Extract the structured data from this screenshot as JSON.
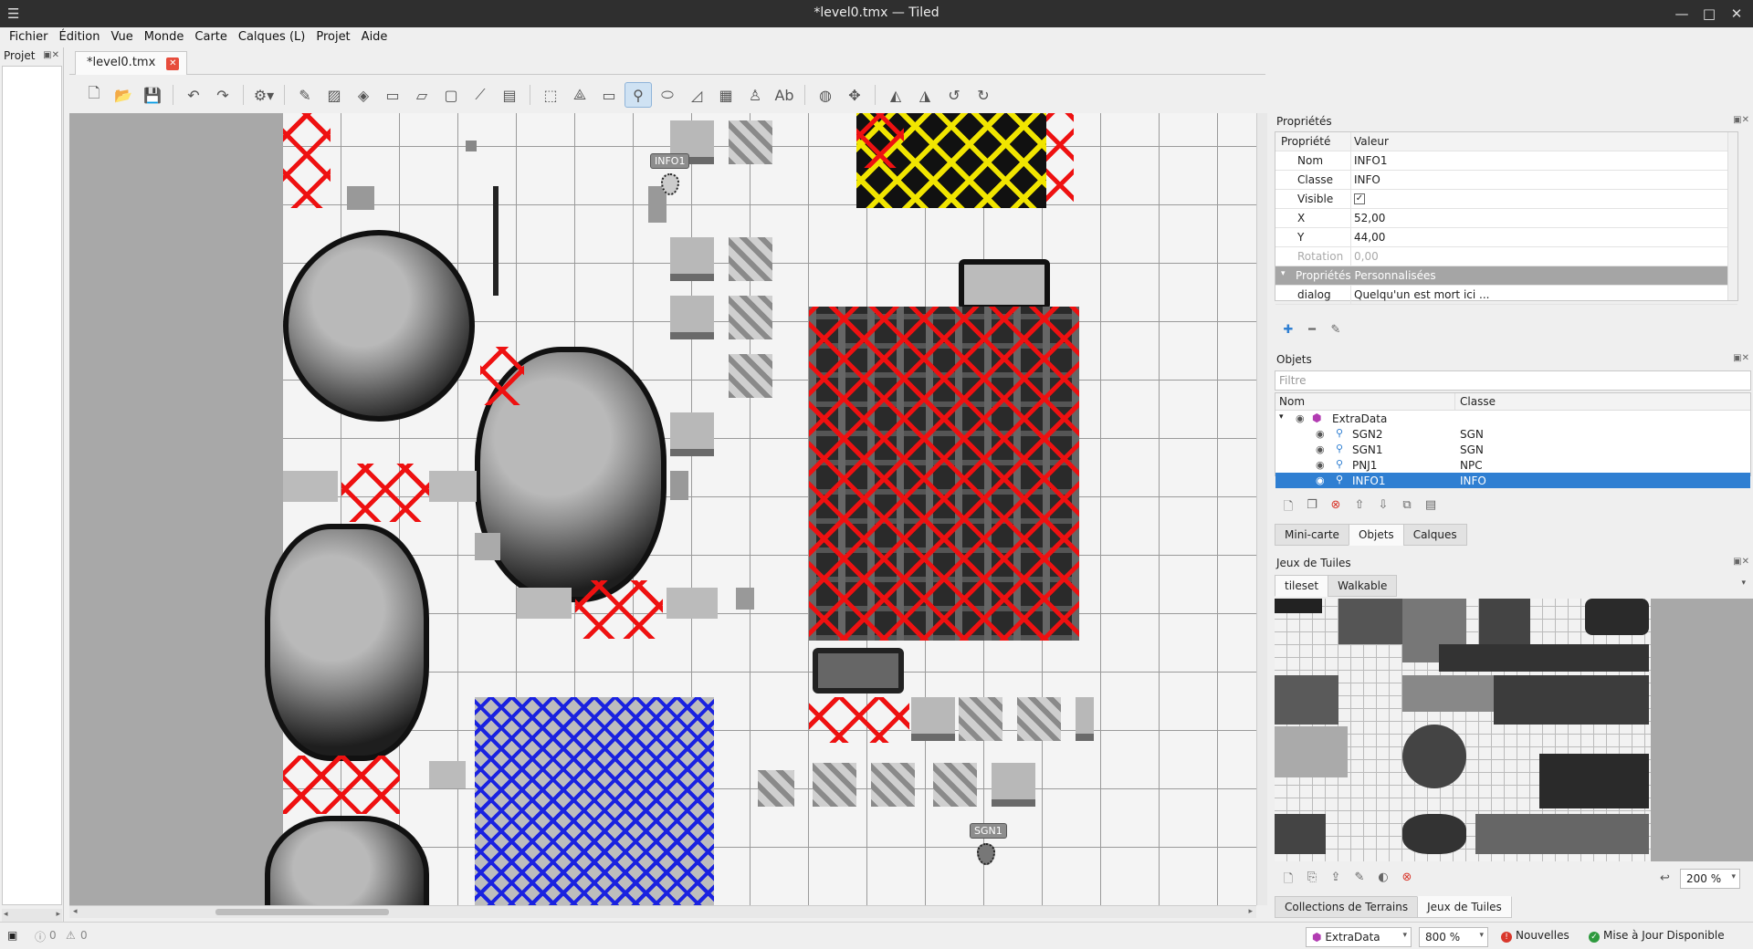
{
  "window": {
    "title": "*level0.tmx — Tiled",
    "minimize": "—",
    "maximize": "□",
    "close": "✕"
  },
  "menu": [
    "Fichier",
    "Édition",
    "Vue",
    "Monde",
    "Carte",
    "Calques (L)",
    "Projet",
    "Aide"
  ],
  "project_dock": {
    "title": "Projet"
  },
  "document_tab": {
    "label": "*level0.tmx"
  },
  "map_objects": {
    "info1_label": "INFO1",
    "sgn1_label": "SGN1"
  },
  "properties": {
    "title": "Propriétés",
    "header_key": "Propriété",
    "header_value": "Valeur",
    "rows": [
      {
        "key": "Nom",
        "value": "INFO1"
      },
      {
        "key": "Classe",
        "value": "INFO"
      },
      {
        "key": "Visible",
        "value": "✓"
      },
      {
        "key": "X",
        "value": "52,00"
      },
      {
        "key": "Y",
        "value": "44,00"
      },
      {
        "key": "Rotation",
        "value": "0,00"
      }
    ],
    "section": "Propriétés Personnalisées",
    "custom": [
      {
        "key": "dialog",
        "value": "Quelqu'un est mort ici ..."
      }
    ]
  },
  "objects": {
    "title": "Objets",
    "filter_placeholder": "Filtre",
    "col_name": "Nom",
    "col_class": "Classe",
    "layer": "ExtraData",
    "items": [
      {
        "name": "SGN2",
        "class": "SGN"
      },
      {
        "name": "SGN1",
        "class": "SGN"
      },
      {
        "name": "PNJ1",
        "class": "NPC"
      },
      {
        "name": "INFO1",
        "class": "INFO"
      }
    ]
  },
  "mid_tabs": [
    "Mini-carte",
    "Objets",
    "Calques"
  ],
  "tilesets": {
    "title": "Jeux de Tuiles",
    "tabs": [
      "tileset",
      "Walkable"
    ],
    "zoom": "200 %"
  },
  "bottom_tabs": [
    "Collections de Terrains",
    "Jeux de Tuiles"
  ],
  "status": {
    "errors": "0",
    "warnings": "0",
    "layer": "ExtraData",
    "zoom": "800 %",
    "news": "Nouvelles",
    "update": "Mise à Jour Disponible"
  }
}
